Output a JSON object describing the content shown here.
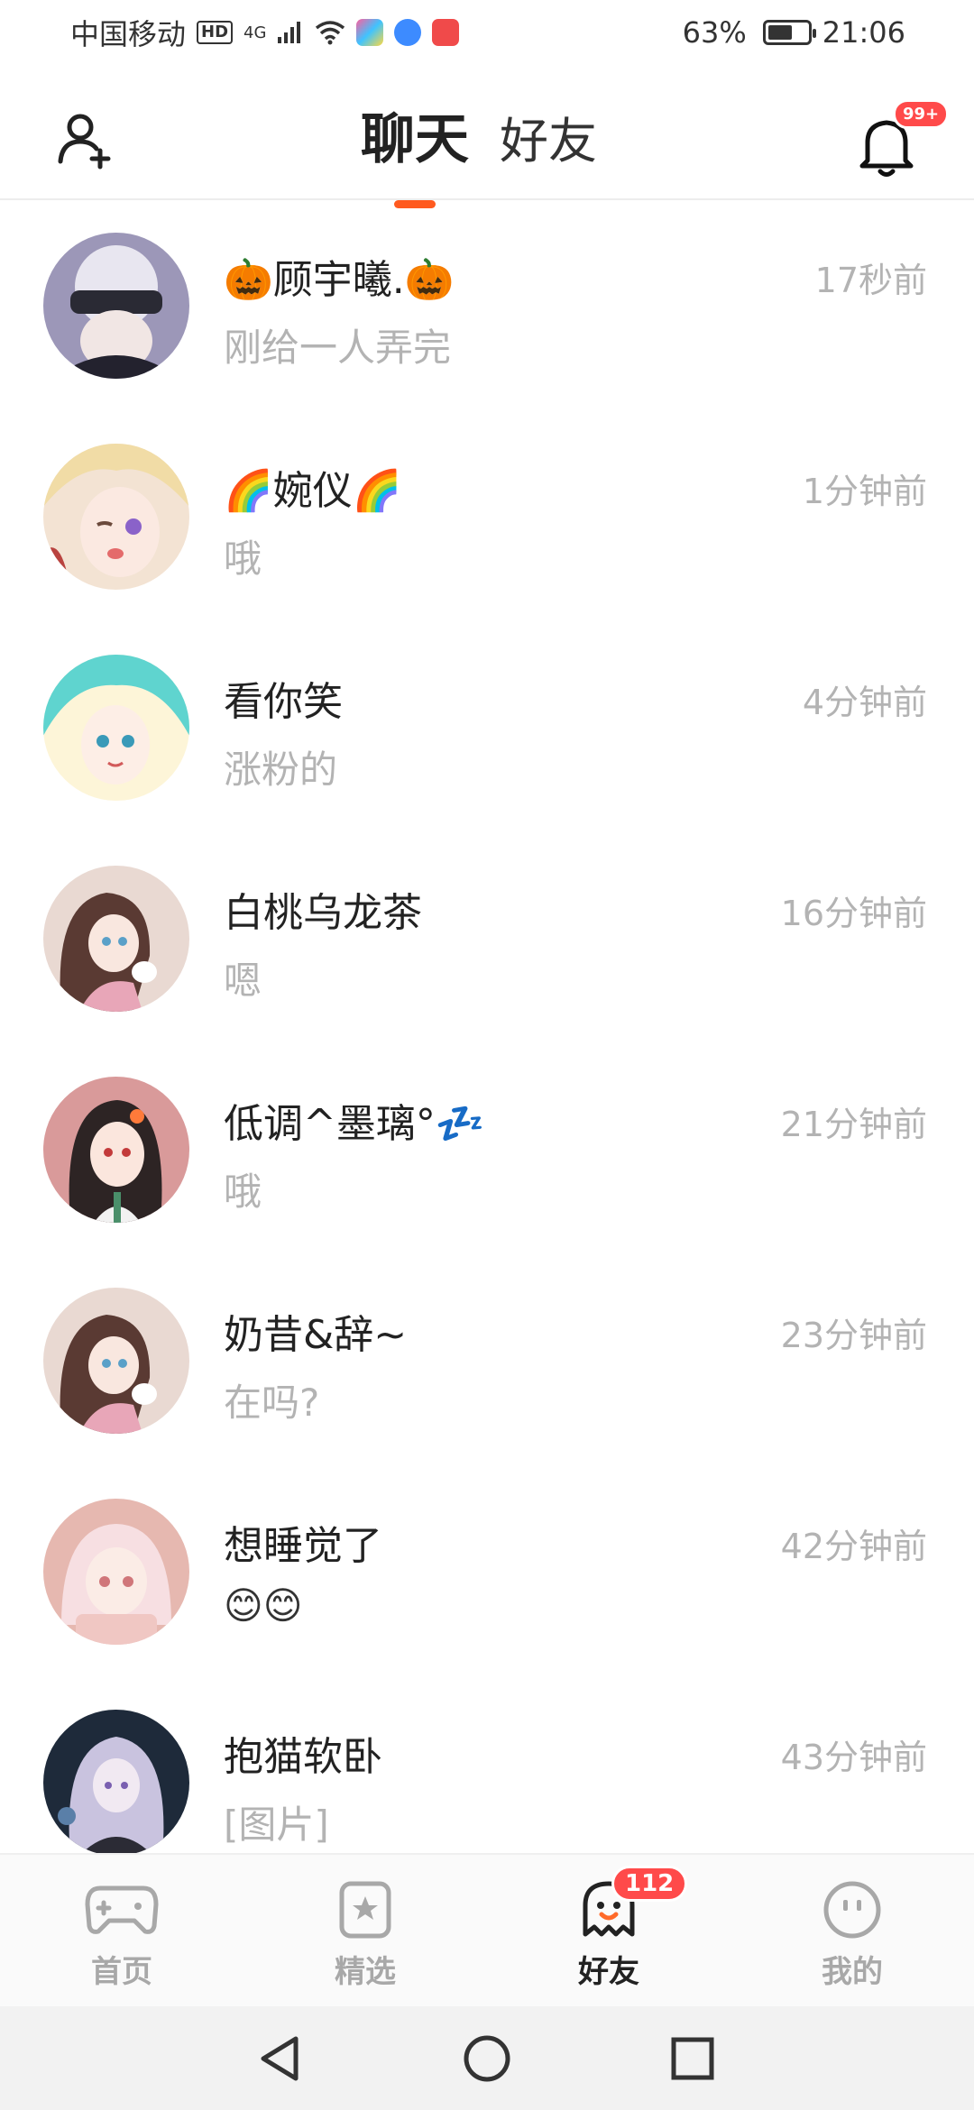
{
  "status_bar": {
    "carrier": "中国移动",
    "hd": "HD",
    "network": "4G",
    "battery": "63%",
    "battery_level": 0.63,
    "time": "21:06"
  },
  "header": {
    "tab_chat": "聊天",
    "tab_friends": "好友",
    "notification_badge": "99+",
    "accent_color": "#ff5a1f"
  },
  "chats": [
    {
      "name": "🎃顾宇曦.🎃",
      "message": "刚给一人弄完",
      "time": "17秒前"
    },
    {
      "name": "🌈婉仪🌈",
      "message": "哦",
      "time": "1分钟前"
    },
    {
      "name": "看你笑",
      "message": "涨粉的",
      "time": "4分钟前"
    },
    {
      "name": "白桃乌龙茶",
      "message": "嗯",
      "time": "16分钟前"
    },
    {
      "name": "低调^墨璃°💤",
      "message": "哦",
      "time": "21分钟前"
    },
    {
      "name": "奶昔&辞~",
      "message": "在吗?",
      "time": "23分钟前"
    },
    {
      "name": "想睡觉了",
      "message": "😊😊",
      "time": "42分钟前"
    },
    {
      "name": "抱猫软卧",
      "message": "[图片]",
      "time": "43分钟前"
    }
  ],
  "tabbar": {
    "home": "首页",
    "featured": "精选",
    "friends": "好友",
    "friends_badge": "112",
    "mine": "我的"
  }
}
